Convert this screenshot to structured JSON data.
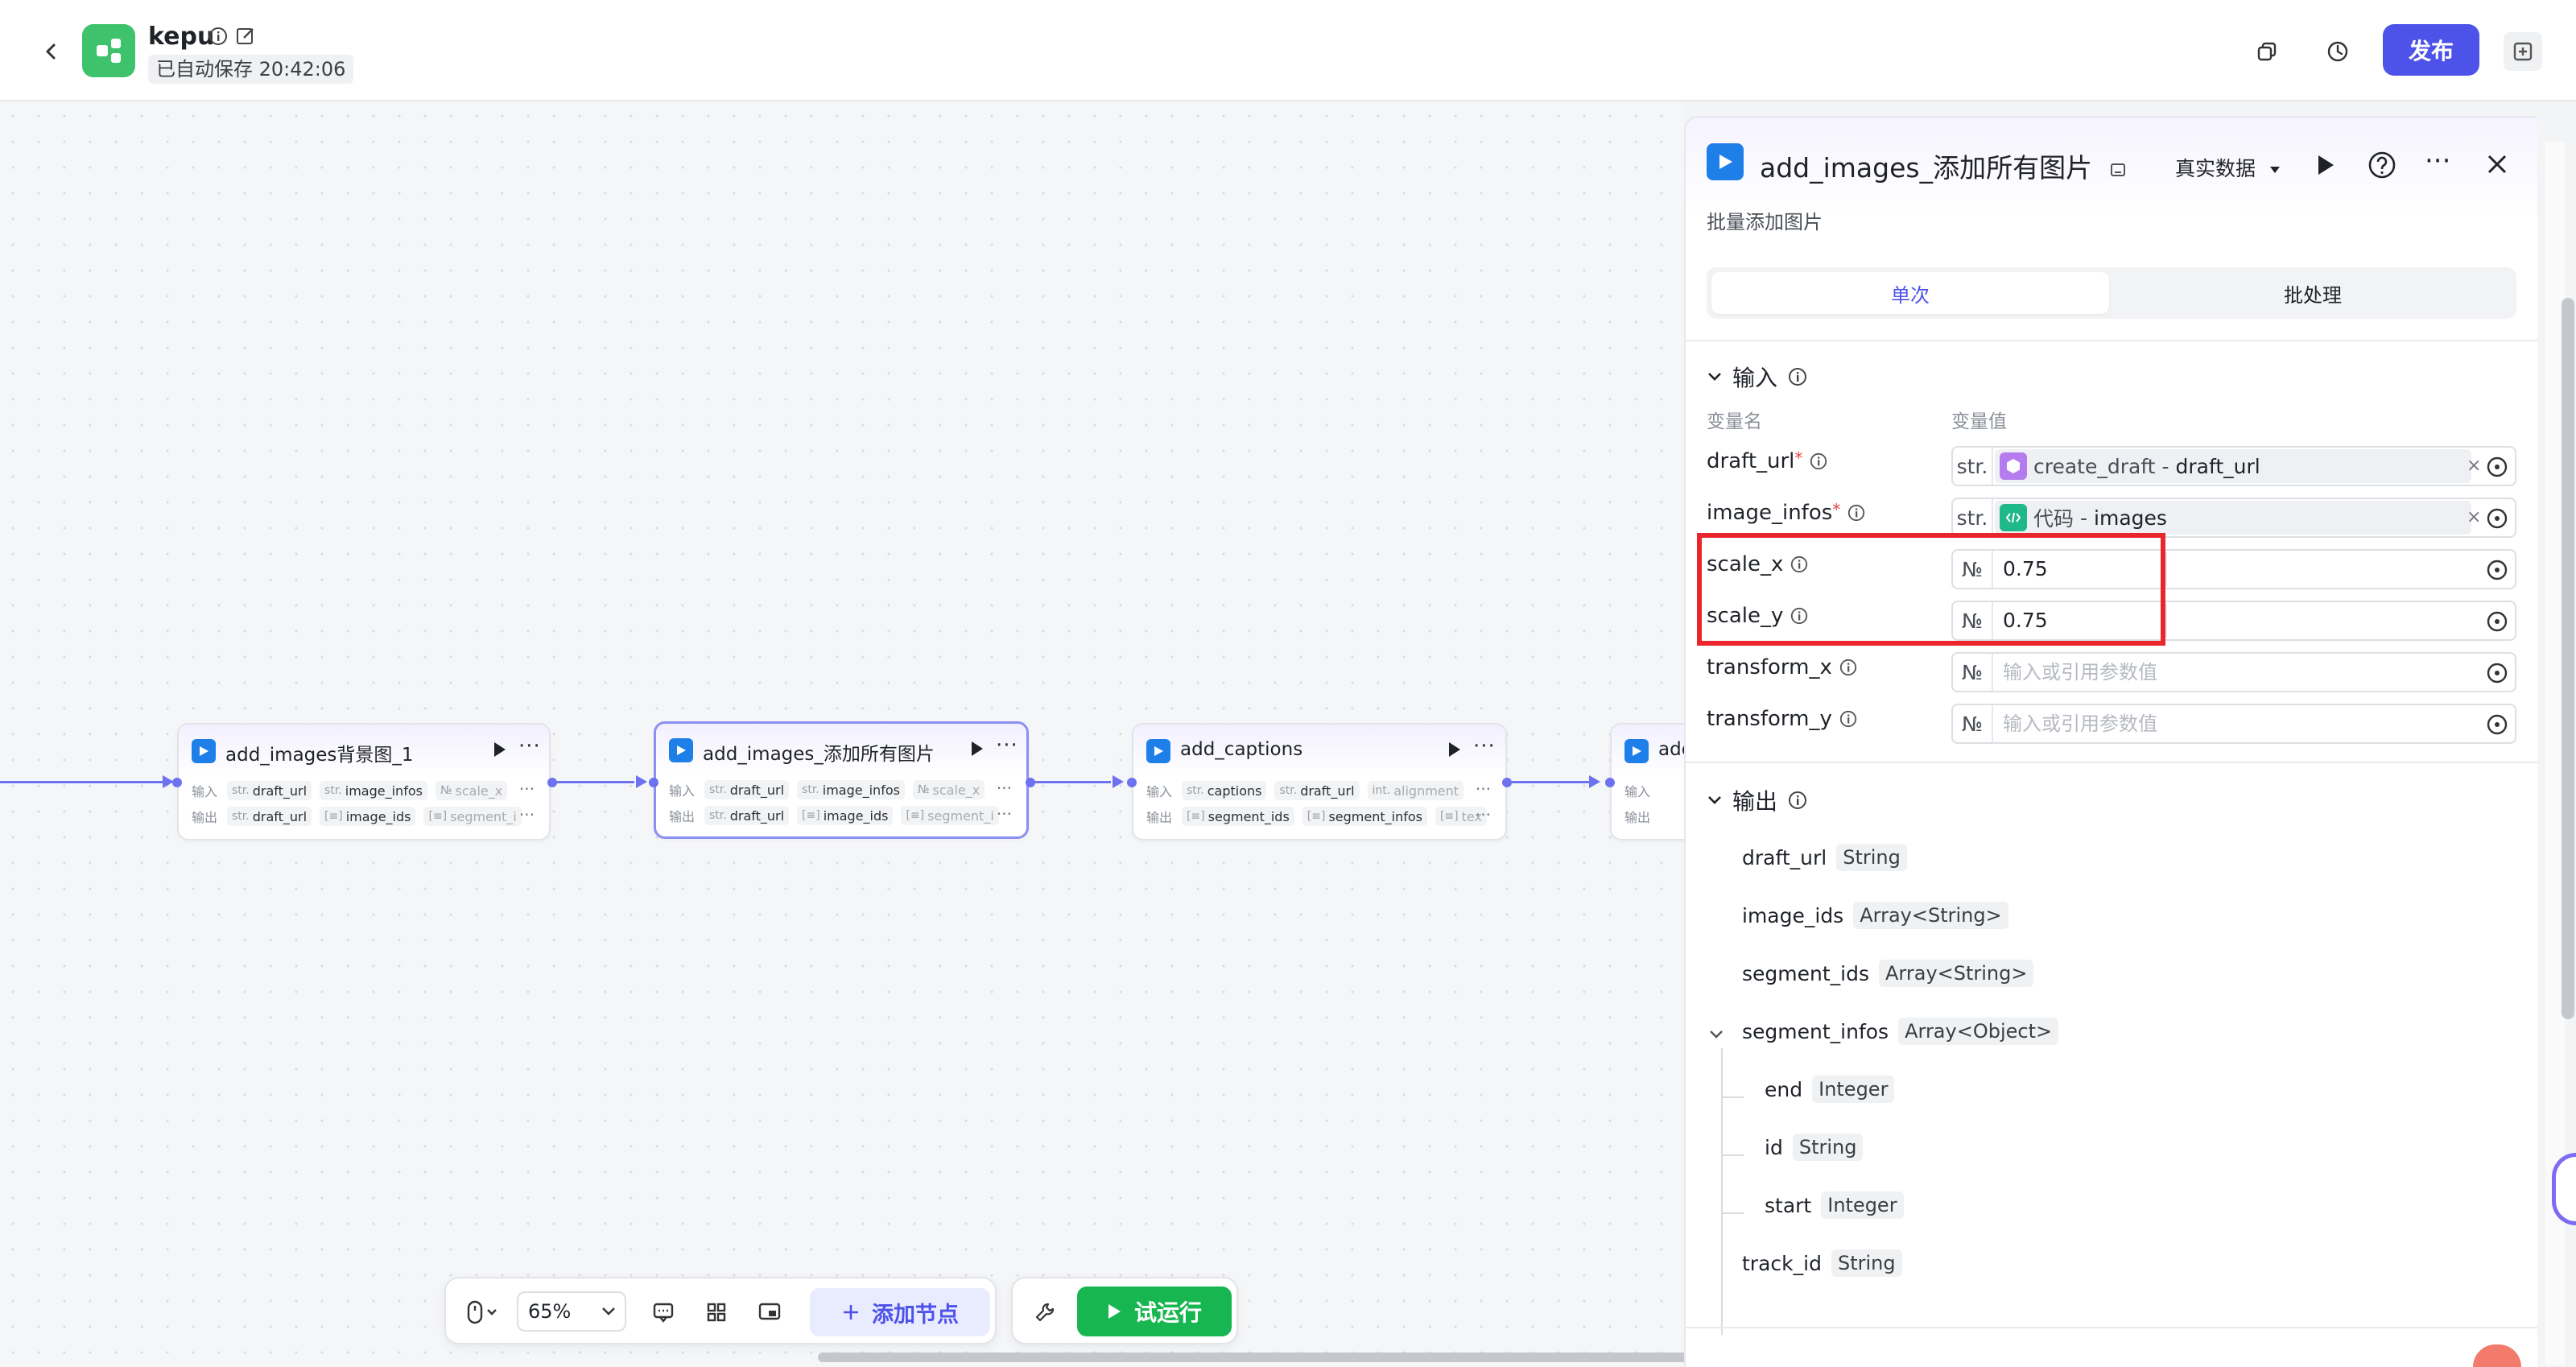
{
  "header": {
    "title": "kepu",
    "autosave": "已自动保存 20:42:06",
    "publish_label": "发布",
    "colors": {
      "accent": "#4d53e8",
      "logo": "#3ec26b"
    }
  },
  "canvas": {
    "nodes": [
      {
        "title": "add_images背景图_1",
        "input_label": "输入",
        "output_label": "输出",
        "inputs": [
          {
            "type": "str.",
            "name": "draft_url"
          },
          {
            "type": "str.",
            "name": "image_infos"
          },
          {
            "type": "№",
            "name": "scale_x"
          }
        ],
        "outputs": [
          {
            "type": "str.",
            "name": "draft_url"
          },
          {
            "type": "[≡]",
            "name": "image_ids"
          },
          {
            "type": "[≡]",
            "name": "segment_i"
          }
        ]
      },
      {
        "title": "add_images_添加所有图片",
        "input_label": "输入",
        "output_label": "输出",
        "inputs": [
          {
            "type": "str.",
            "name": "draft_url"
          },
          {
            "type": "str.",
            "name": "image_infos"
          },
          {
            "type": "№",
            "name": "scale_x"
          }
        ],
        "outputs": [
          {
            "type": "str.",
            "name": "draft_url"
          },
          {
            "type": "[≡]",
            "name": "image_ids"
          },
          {
            "type": "[≡]",
            "name": "segment_i"
          }
        ]
      },
      {
        "title": "add_captions",
        "input_label": "输入",
        "output_label": "输出",
        "inputs": [
          {
            "type": "str.",
            "name": "captions"
          },
          {
            "type": "str.",
            "name": "draft_url"
          },
          {
            "type": "int.",
            "name": "alignment"
          }
        ],
        "outputs": [
          {
            "type": "[≡]",
            "name": "segment_ids"
          },
          {
            "type": "[≡]",
            "name": "segment_infos"
          },
          {
            "type": "[≡]",
            "name": "tex"
          }
        ]
      },
      {
        "title": "add",
        "input_label": "输入",
        "output_label": "输出"
      }
    ]
  },
  "toolbar": {
    "zoom": "65%",
    "add_node_label": "添加节点",
    "run_label": "试运行"
  },
  "panel": {
    "title": "add_images_添加所有图片",
    "subtitle": "批量添加图片",
    "data_mode": "真实数据",
    "tabs": [
      {
        "label": "单次"
      },
      {
        "label": "批处理"
      }
    ],
    "input_section": {
      "title": "输入",
      "col_name": "变量名",
      "col_value": "变量值",
      "fields": [
        {
          "name": "draft_url",
          "required": true,
          "type": "str.",
          "ref_source": "create_draft",
          "ref_sep": "-",
          "ref_var": "draft_url",
          "clear": "×"
        },
        {
          "name": "image_infos",
          "required": true,
          "type": "str.",
          "ref_source": "代码",
          "ref_sep": "-",
          "ref_var": "images",
          "clear": "×"
        },
        {
          "name": "scale_x",
          "type": "№",
          "value": "0.75"
        },
        {
          "name": "scale_y",
          "type": "№",
          "value": "0.75"
        },
        {
          "name": "transform_x",
          "type": "№",
          "placeholder": "输入或引用参数值"
        },
        {
          "name": "transform_y",
          "type": "№",
          "placeholder": "输入或引用参数值"
        }
      ]
    },
    "output_section": {
      "title": "输出",
      "fields": [
        {
          "name": "draft_url",
          "type": "String"
        },
        {
          "name": "image_ids",
          "type": "Array<String>"
        },
        {
          "name": "segment_ids",
          "type": "Array<String>"
        },
        {
          "name": "segment_infos",
          "type": "Array<Object>"
        },
        {
          "name": "end",
          "type": "Integer"
        },
        {
          "name": "id",
          "type": "String"
        },
        {
          "name": "start",
          "type": "Integer"
        },
        {
          "name": "track_id",
          "type": "String"
        }
      ]
    },
    "colors": {
      "highlight": "#e8262b",
      "tab_active": "#4d53e8",
      "run": "#18b650"
    }
  }
}
